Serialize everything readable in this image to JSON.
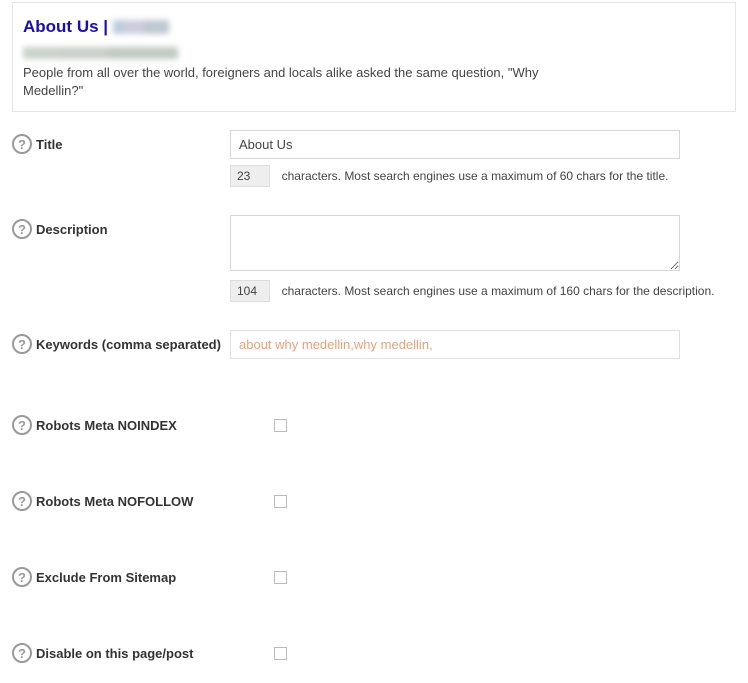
{
  "preview": {
    "title_prefix": "About Us | ",
    "description": "People from all over the world, foreigners and locals alike asked the same question, \"Why Medellin?\""
  },
  "fields": {
    "title": {
      "label": "Title",
      "value": "About Us",
      "count": "23",
      "count_msg": "characters. Most search engines use a maximum of 60 chars for the title."
    },
    "description": {
      "label": "Description",
      "value": "",
      "count": "104",
      "count_msg": "characters. Most search engines use a maximum of 160 chars for the description."
    },
    "keywords": {
      "label": "Keywords (comma separated)",
      "value": "about why medellin,why medellin,"
    },
    "noindex": {
      "label": "Robots Meta NOINDEX"
    },
    "nofollow": {
      "label": "Robots Meta NOFOLLOW"
    },
    "exclude": {
      "label": "Exclude From Sitemap"
    },
    "disable": {
      "label": "Disable on this page/post"
    }
  }
}
